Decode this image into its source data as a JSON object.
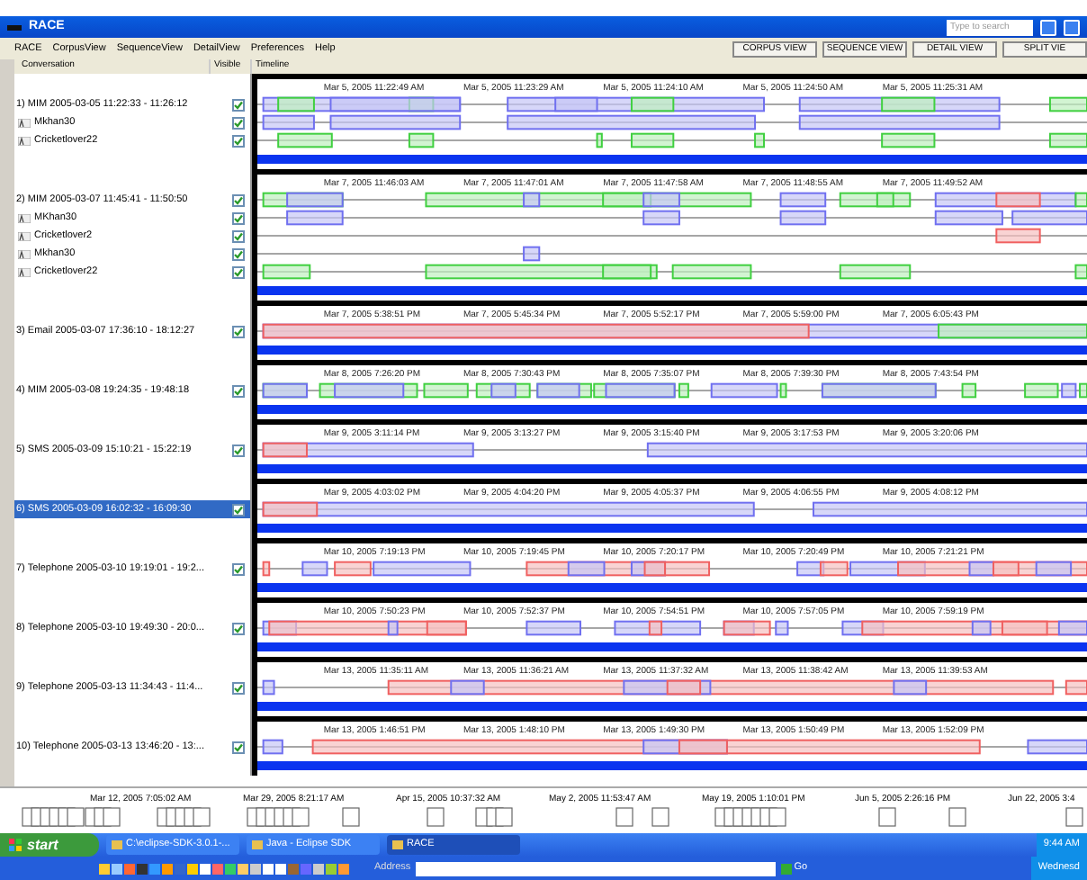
{
  "window": {
    "title": "RACE",
    "search": {
      "placeholder": "Type to search"
    }
  },
  "menu": [
    "RACE",
    "CorpusView",
    "SequenceView",
    "DetailView",
    "Preferences",
    "Help"
  ],
  "view_buttons": [
    "CORPUS VIEW",
    "SEQUENCE VIEW",
    "DETAIL VIEW",
    "SPLIT VIE"
  ],
  "columns": [
    "Conversation",
    "Visible",
    "Timeline"
  ],
  "conversations": [
    {
      "label": "1) MIM 2005-03-05 11:22:33 - 11:26:12",
      "visible": true,
      "selected": false,
      "participants": [
        {
          "name": "Mkhan30",
          "visible": true
        },
        {
          "name": "Cricketlover22",
          "visible": true
        }
      ],
      "ticks": [
        "Mar 5, 2005 11:22:49 AM",
        "Mar 5, 2005 11:23:29 AM",
        "Mar 5, 2005 11:24:10 AM",
        "Mar 5, 2005 11:24:50 AM",
        "Mar 5, 2005 11:25:31 AM"
      ]
    },
    {
      "label": "2) MIM 2005-03-07 11:45:41 - 11:50:50",
      "visible": true,
      "selected": false,
      "participants": [
        {
          "name": "MKhan30",
          "visible": true
        },
        {
          "name": "Cricketlover2",
          "visible": true
        },
        {
          "name": "Mkhan30",
          "visible": true
        },
        {
          "name": "Cricketlover22",
          "visible": true
        }
      ],
      "ticks": [
        "Mar 7, 2005 11:46:03 AM",
        "Mar 7, 2005 11:47:01 AM",
        "Mar 7, 2005 11:47:58 AM",
        "Mar 7, 2005 11:48:55 AM",
        "Mar 7, 2005 11:49:52 AM"
      ]
    },
    {
      "label": "3) Email 2005-03-07 17:36:10 - 18:12:27",
      "visible": true,
      "selected": false,
      "ticks": [
        "Mar 7, 2005 5:38:51 PM",
        "Mar 7, 2005 5:45:34 PM",
        "Mar 7, 2005 5:52:17 PM",
        "Mar 7, 2005 5:59:00 PM",
        "Mar 7, 2005 6:05:43 PM"
      ]
    },
    {
      "label": "4) MIM 2005-03-08 19:24:35 - 19:48:18",
      "visible": true,
      "selected": false,
      "ticks": [
        "Mar 8, 2005 7:26:20 PM",
        "Mar 8, 2005 7:30:43 PM",
        "Mar 8, 2005 7:35:07 PM",
        "Mar 8, 2005 7:39:30 PM",
        "Mar 8, 2005 7:43:54 PM"
      ]
    },
    {
      "label": "5) SMS 2005-03-09 15:10:21 - 15:22:19",
      "visible": true,
      "selected": false,
      "ticks": [
        "Mar 9, 2005 3:11:14 PM",
        "Mar 9, 2005 3:13:27 PM",
        "Mar 9, 2005 3:15:40 PM",
        "Mar 9, 2005 3:17:53 PM",
        "Mar 9, 2005 3:20:06 PM"
      ]
    },
    {
      "label": "6) SMS 2005-03-09 16:02:32 - 16:09:30",
      "visible": true,
      "selected": true,
      "ticks": [
        "Mar 9, 2005 4:03:02 PM",
        "Mar 9, 2005 4:04:20 PM",
        "Mar 9, 2005 4:05:37 PM",
        "Mar 9, 2005 4:06:55 PM",
        "Mar 9, 2005 4:08:12 PM"
      ]
    },
    {
      "label": "7) Telephone 2005-03-10 19:19:01 - 19:2...",
      "visible": true,
      "selected": false,
      "ticks": [
        "Mar 10, 2005 7:19:13 PM",
        "Mar 10, 2005 7:19:45 PM",
        "Mar 10, 2005 7:20:17 PM",
        "Mar 10, 2005 7:20:49 PM",
        "Mar 10, 2005 7:21:21 PM"
      ]
    },
    {
      "label": "8) Telephone 2005-03-10 19:49:30 - 20:0...",
      "visible": true,
      "selected": false,
      "ticks": [
        "Mar 10, 2005 7:50:23 PM",
        "Mar 10, 2005 7:52:37 PM",
        "Mar 10, 2005 7:54:51 PM",
        "Mar 10, 2005 7:57:05 PM",
        "Mar 10, 2005 7:59:19 PM"
      ]
    },
    {
      "label": "9) Telephone 2005-03-13 11:34:43 - 11:4...",
      "visible": true,
      "selected": false,
      "ticks": [
        "Mar 13, 2005 11:35:11 AM",
        "Mar 13, 2005 11:36:21 AM",
        "Mar 13, 2005 11:37:32 AM",
        "Mar 13, 2005 11:38:42 AM",
        "Mar 13, 2005 11:39:53 AM"
      ]
    },
    {
      "label": "10) Telephone 2005-03-13 13:46:20 - 13:...",
      "visible": true,
      "selected": false,
      "ticks": [
        "Mar 13, 2005 1:46:51 PM",
        "Mar 13, 2005 1:48:10 PM",
        "Mar 13, 2005 1:49:30 PM",
        "Mar 13, 2005 1:50:49 PM",
        "Mar 13, 2005 1:52:09 PM"
      ]
    }
  ],
  "overview": {
    "ticks": [
      "Mar 12, 2005 7:05:02 AM",
      "Mar 29, 2005 8:21:17 AM",
      "Apr 15, 2005 10:37:32 AM",
      "May 2, 2005 11:53:47 AM",
      "May 19, 2005 1:10:01 PM",
      "Jun 5, 2005 2:26:16 PM",
      "Jun 22, 2005 3:4"
    ]
  },
  "taskbar": {
    "start": "start",
    "tasks": [
      {
        "label": "C:\\eclipse-SDK-3.0.1-...",
        "selected": false
      },
      {
        "label": "Java - Eclipse SDK",
        "selected": false
      },
      {
        "label": "RACE",
        "selected": true
      }
    ],
    "address_label": "Address",
    "go": "Go",
    "clock": "9:44 AM",
    "day": "Wednesd"
  }
}
